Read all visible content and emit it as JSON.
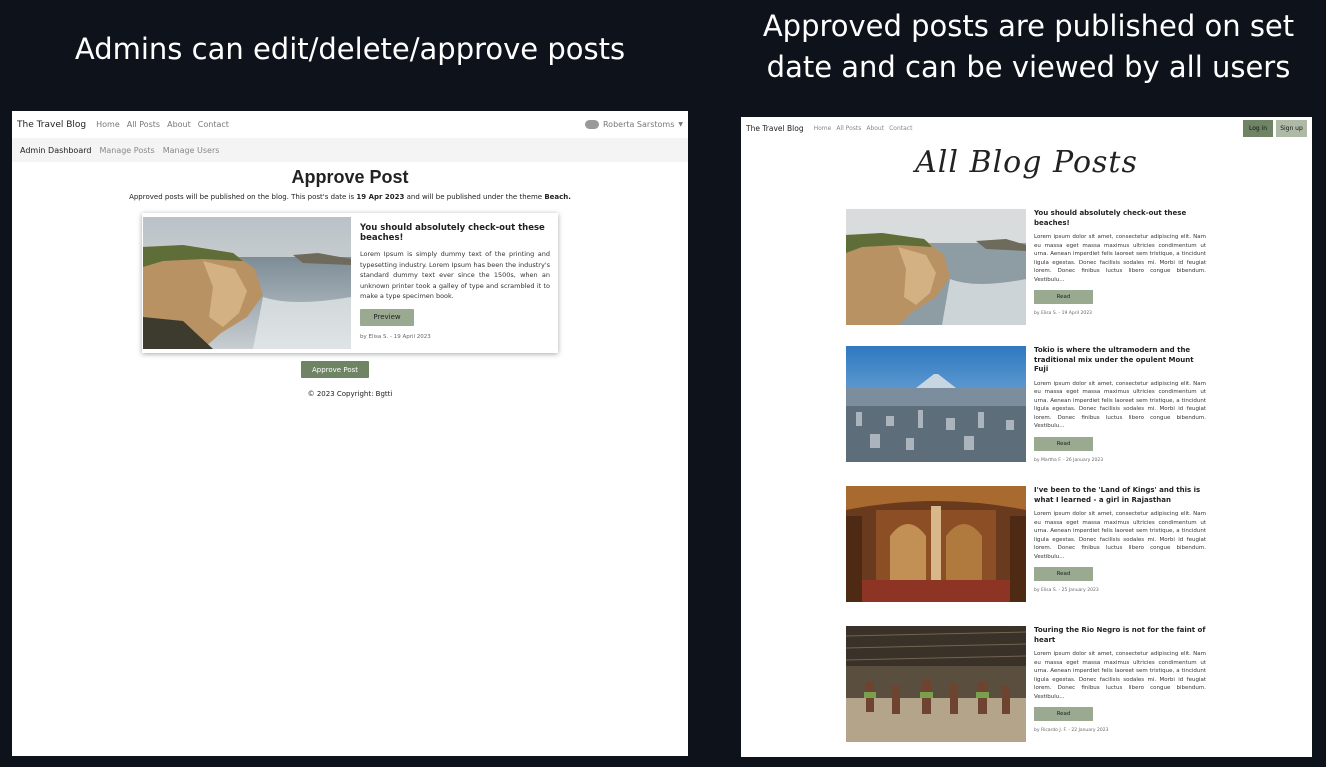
{
  "captions": {
    "left": "Admins can edit/delete/approve posts",
    "right": "Approved posts are published on set date and can be viewed by all users"
  },
  "admin_view": {
    "brand": "The Travel Blog",
    "nav": [
      "Home",
      "All Posts",
      "About",
      "Contact"
    ],
    "user_name": "Roberta Sarstoms",
    "subnav": [
      "Admin Dashboard",
      "Manage Posts",
      "Manage Users"
    ],
    "page_title": "Approve Post",
    "note_prefix": "Approved posts will be published on the blog. This post's date is ",
    "note_date": "19 Apr 2023",
    "note_middle": " and will be published under the theme ",
    "note_theme": "Beach.",
    "card": {
      "title": "You should absolutely check-out these beaches!",
      "text": "Lorem Ipsum is simply dummy text of the printing and typesetting industry. Lorem Ipsum has been the industry's standard dummy text ever since the 1500s, when an unknown printer took a galley of type and scrambled it to make a type specimen book.",
      "button": "Preview",
      "byline": "by Elisa S. - 19 April 2023"
    },
    "approve_button": "Approve Post",
    "copyright": "© 2023 Copyright: Bgtti"
  },
  "public_view": {
    "brand": "The Travel Blog",
    "nav": [
      "Home",
      "All Posts",
      "About",
      "Contact"
    ],
    "login": "Log in",
    "signup": "Sign up",
    "title": "All Blog Posts",
    "posts": [
      {
        "title": "You should absolutely check-out these beaches!",
        "text": "Lorem ipsum dolor sit amet, consectetur adipiscing elit. Nam eu massa eget massa maximus ultricies condimentum ut urna. Aenean imperdiet felis laoreet sem tristique, a tincidunt ligula egestas. Donec facilisis sodales mi. Morbi id feugiat lorem. Donec finibus luctus libero congue bibendum. Vestibulu...",
        "button": "Read",
        "byline": "by Elisa S. - 19 April 2023"
      },
      {
        "title": "Tokio is where the ultramodern and the traditional mix under the opulent Mount Fuji",
        "text": "Lorem ipsum dolor sit amet, consectetur adipiscing elit. Nam eu massa eget massa maximus ultricies condimentum ut urna. Aenean imperdiet felis laoreet sem tristique, a tincidunt ligula egestas. Donec facilisis sodales mi. Morbi id feugiat lorem. Donec finibus luctus libero congue bibendum. Vestibulu...",
        "button": "Read",
        "byline": "by Martha F. - 26 January 2023"
      },
      {
        "title": "I've been to the 'Land of Kings' and this is what I learned - a girl in Rajasthan",
        "text": "Lorem ipsum dolor sit amet, consectetur adipiscing elit. Nam eu massa eget massa maximus ultricies condimentum ut urna. Aenean imperdiet felis laoreet sem tristique, a tincidunt ligula egestas. Donec facilisis sodales mi. Morbi id feugiat lorem. Donec finibus luctus libero congue bibendum. Vestibulu...",
        "button": "Read",
        "byline": "by Elisa S. - 25 January 2023"
      },
      {
        "title": "Touring the Rio Negro is not for the faint of heart",
        "text": "Lorem ipsum dolor sit amet, consectetur adipiscing elit. Nam eu massa eget massa maximus ultricies condimentum ut urna. Aenean imperdiet felis laoreet sem tristique, a tincidunt ligula egestas. Donec facilisis sodales mi. Morbi id feugiat lorem. Donec finibus luctus libero congue bibendum. Vestibulu...",
        "button": "Read",
        "byline": "by Ricardo J. F. - 22 January 2023"
      }
    ]
  },
  "colors": {
    "background": "#0d121b",
    "button_green": "#6e8465",
    "button_sage": "#9aaa90"
  }
}
